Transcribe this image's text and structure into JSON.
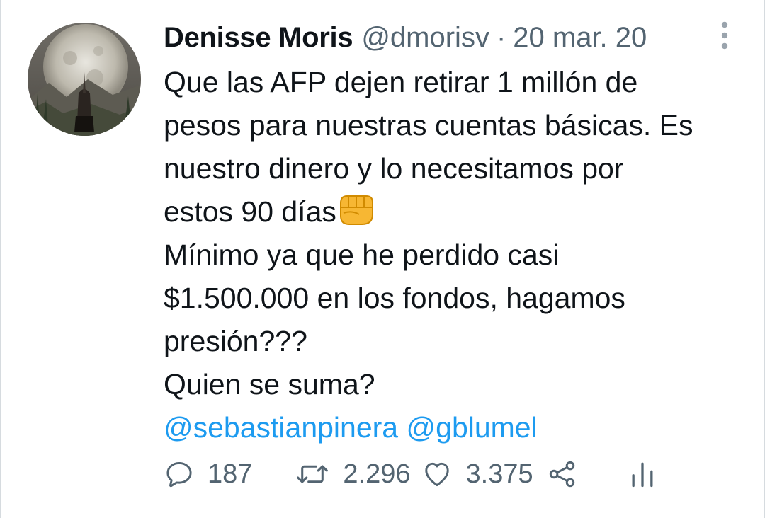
{
  "author": {
    "name": "Denisse Moris",
    "handle": "@dmorisv",
    "separator": "·",
    "date": "20 mar. 20"
  },
  "body": {
    "lines": [
      "Que las AFP dejen retirar 1 millón de",
      "pesos para nuestras cuentas básicas. Es",
      "nuestro dinero y lo necesitamos por",
      "estos 90 días",
      "Mínimo ya que he perdido casi",
      "$1.500.000 en los fondos, hagamos",
      "presión???",
      "Quien se suma?"
    ],
    "emoji": "oncoming-fist-emoji",
    "mentions": [
      "@sebastianpinera",
      "@gblumel"
    ]
  },
  "actions": {
    "replies": "187",
    "retweets": "2.296",
    "likes": "3.375"
  },
  "icons": {
    "reply": "speech-bubble-icon",
    "retweet": "retweet-arrows-icon",
    "like": "heart-icon",
    "share": "share-icon",
    "analytics": "analytics-bars-icon",
    "more": "vertical-dots-icon"
  },
  "colors": {
    "text": "#0f1419",
    "secondary": "#536471",
    "link": "#1d9bf0",
    "background": "#ffffff"
  }
}
